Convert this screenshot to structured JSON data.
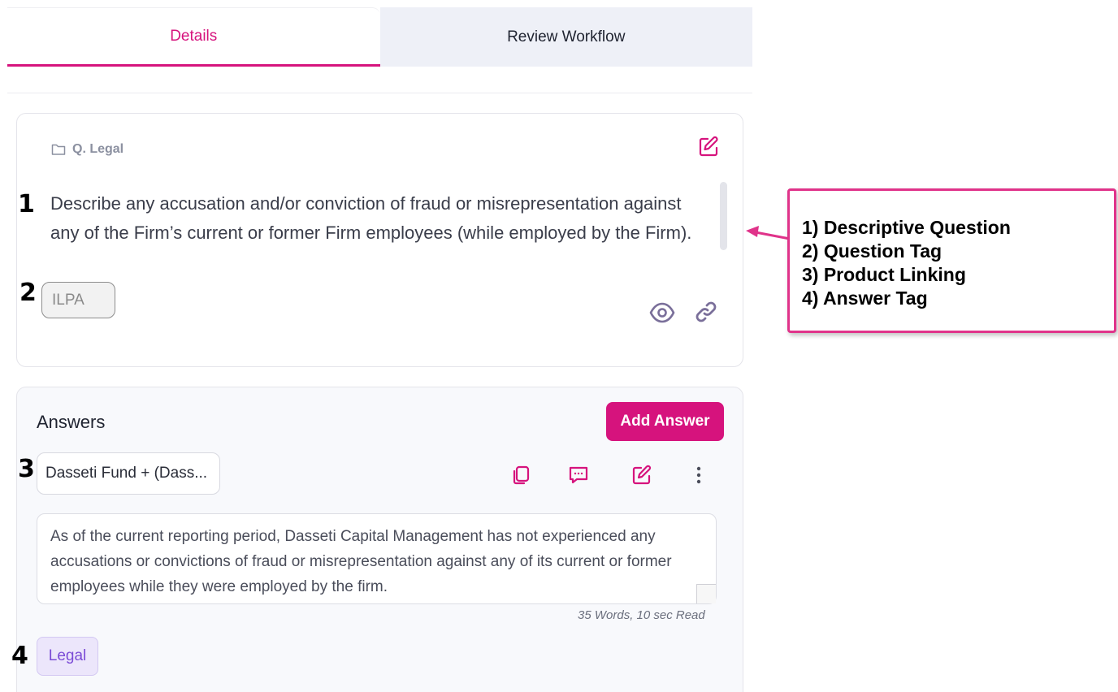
{
  "tabs": [
    {
      "label": "Details",
      "active": true
    },
    {
      "label": "Review Workflow",
      "active": false
    }
  ],
  "question": {
    "folder": "Q. Legal",
    "text": "Describe any accusation and/or conviction of fraud or misrepresentation against any of the Firm’s current or former Firm employees (while employed by the Firm).",
    "tag": "ILPA"
  },
  "answers": {
    "title": "Answers",
    "add_button": "Add Answer",
    "product": "Dasseti Fund + (Dass...",
    "text": "As of the current reporting period, Dasseti Capital Management has not experienced any accusations or convictions of fraud or misrepresentation against any of its current or former employees while they were employed by the firm.",
    "word_count": "35 Words, 10 sec Read",
    "tag": "Legal"
  },
  "markers": [
    "1",
    "2",
    "3",
    "4"
  ],
  "callout": {
    "lines": [
      "1) Descriptive Question",
      "2) Question Tag",
      "3) Product Linking",
      "4) Answer Tag"
    ]
  },
  "colors": {
    "accent": "#d6137d",
    "icon_gray": "#7a6f9a",
    "tag_purple": "#7b4cd6",
    "callout_border": "#e0338a"
  },
  "icons": [
    "folder-icon",
    "edit-icon",
    "eye-icon",
    "link-icon",
    "copy-icon",
    "comment-icon",
    "more-vertical-icon"
  ]
}
